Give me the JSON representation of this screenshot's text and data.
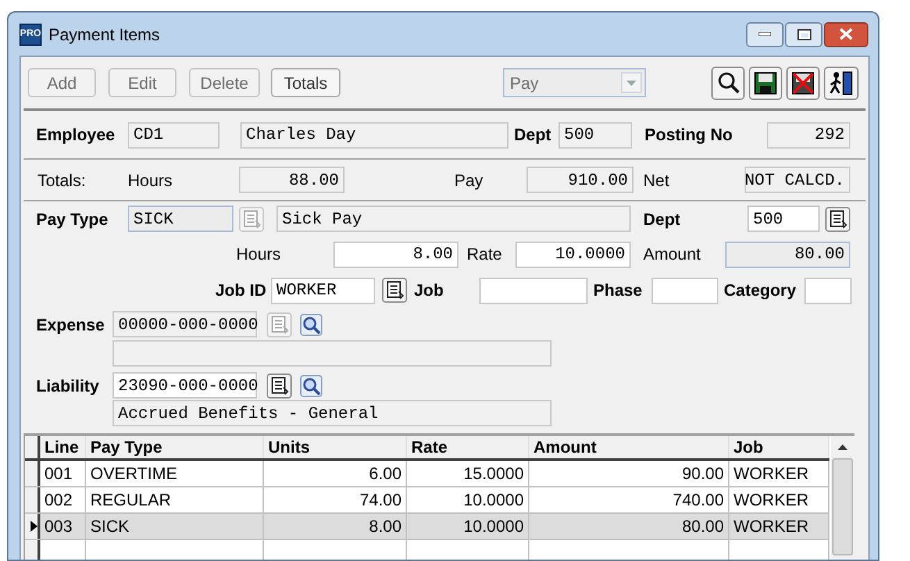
{
  "window": {
    "badge": "PRO",
    "title": "Payment Items"
  },
  "toolbar": {
    "buttons": [
      {
        "label": "Add",
        "disabled": true
      },
      {
        "label": "Edit",
        "disabled": true
      },
      {
        "label": "Delete",
        "disabled": true
      },
      {
        "label": "Totals",
        "disabled": false
      }
    ],
    "type_select": {
      "value": "Pay",
      "disabled": true
    }
  },
  "employee": {
    "label": "Employee",
    "code": "CD1",
    "name": "Charles Day",
    "dept_label": "Dept",
    "dept": "500",
    "posting_label": "Posting No",
    "posting_no": "292"
  },
  "totals": {
    "label": "Totals:",
    "hours_label": "Hours",
    "hours": "88.00",
    "pay_label": "Pay",
    "pay": "910.00",
    "net_label": "Net",
    "net": "NOT CALCD."
  },
  "pay_type": {
    "label": "Pay Type",
    "code": "SICK",
    "description": "Sick Pay",
    "dept_label": "Dept",
    "dept": "500",
    "hours_label": "Hours",
    "hours": "8.00",
    "rate_label": "Rate",
    "rate": "10.0000",
    "amount_label": "Amount",
    "amount": "80.00",
    "job_id_label": "Job ID",
    "job_id": "WORKER",
    "job_label": "Job",
    "phase_label": "Phase",
    "category_label": "Category"
  },
  "expense": {
    "label": "Expense",
    "account": "00000-000-0000"
  },
  "liability": {
    "label": "Liability",
    "account": "23090-000-0000",
    "description": "Accrued Benefits - General"
  },
  "table": {
    "columns": [
      "Line",
      "Pay Type",
      "Units",
      "Rate",
      "Amount",
      "Job"
    ],
    "rows": [
      {
        "selected": false,
        "cells": [
          "001",
          "OVERTIME",
          "6.00",
          "15.0000",
          "90.00",
          "WORKER"
        ]
      },
      {
        "selected": false,
        "cells": [
          "002",
          "REGULAR",
          "74.00",
          "10.0000",
          "740.00",
          "WORKER"
        ]
      },
      {
        "selected": true,
        "cells": [
          "003",
          "SICK",
          "8.00",
          "10.0000",
          "80.00",
          "WORKER"
        ]
      }
    ]
  }
}
